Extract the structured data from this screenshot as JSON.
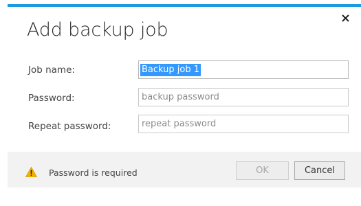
{
  "dialog": {
    "title": "Add backup job",
    "close_label": "×",
    "accent_color": "#1e9be0"
  },
  "form": {
    "job_name": {
      "label": "Job name:",
      "value": "Backup job 1",
      "selected": true
    },
    "password": {
      "label": "Password:",
      "value": "",
      "placeholder": "backup password"
    },
    "repeat_password": {
      "label": "Repeat password:",
      "value": "",
      "placeholder": "repeat password"
    }
  },
  "footer": {
    "warning_icon": "warning-triangle-icon",
    "warning_text": "Password is required",
    "ok_label": "OK",
    "ok_enabled": false,
    "cancel_label": "Cancel"
  }
}
